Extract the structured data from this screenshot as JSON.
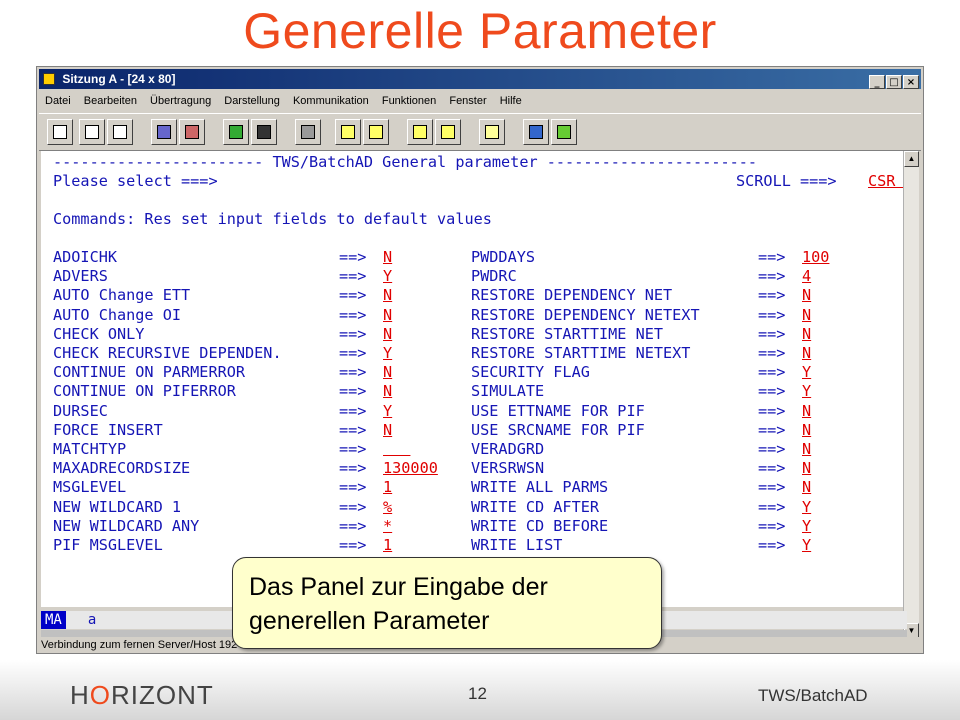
{
  "slide": {
    "title": "Generelle Parameter",
    "callout_line1": "Das Panel zur Eingabe der",
    "callout_line2": "generellen Parameter",
    "brand_pre": "H",
    "brand_o": "O",
    "brand_post": "RIZONT",
    "page_number": "12",
    "product": "TWS/BatchAD"
  },
  "window": {
    "title": "Sitzung A - [24 x 80]",
    "menu": [
      "Datei",
      "Bearbeiten",
      "Übertragung",
      "Darstellung",
      "Kommunikation",
      "Funktionen",
      "Fenster",
      "Hilfe"
    ],
    "toolbar_icons": [
      "print-screen-icon",
      "copy-icon",
      "paste-icon",
      "send-file-icon",
      "receive-file-icon",
      "display-setup-icon",
      "color-icon",
      "macro-icon",
      "record-macro-icon",
      "play-macro-icon",
      "stop-macro-icon",
      "pause-macro-icon",
      "clipboard-icon",
      "help-icon",
      "support-icon"
    ],
    "status_ma": "MA",
    "status_cursor": "a",
    "connection_text": "Verbindung zum fernen Server/Host 192"
  },
  "terminal": {
    "header_line": "----------------------- TWS/BatchAD General parameter -----------------------",
    "prompt_label": "Please select ===>",
    "scroll_label": "SCROLL ===>",
    "scroll_value": "CSR ",
    "commands_line": "Commands: Res set input fields to default values",
    "arrow": "==>",
    "left_params": [
      {
        "name": "ADOICHK",
        "value": "N"
      },
      {
        "name": "ADVERS",
        "value": "Y"
      },
      {
        "name": "AUTO Change ETT",
        "value": "N"
      },
      {
        "name": "AUTO Change OI",
        "value": "N"
      },
      {
        "name": "CHECK ONLY",
        "value": "N"
      },
      {
        "name": "CHECK RECURSIVE DEPENDEN.",
        "value": "Y"
      },
      {
        "name": "CONTINUE ON PARMERROR",
        "value": "N"
      },
      {
        "name": "CONTINUE ON PIFERROR",
        "value": "N"
      },
      {
        "name": "DURSEC",
        "value": "Y"
      },
      {
        "name": "FORCE INSERT",
        "value": "N"
      },
      {
        "name": "MATCHTYP",
        "value": "   "
      },
      {
        "name": "MAXADRECORDSIZE",
        "value": "130000"
      },
      {
        "name": "MSGLEVEL",
        "value": "1"
      },
      {
        "name": "NEW WILDCARD 1",
        "value": "%"
      },
      {
        "name": "NEW WILDCARD ANY",
        "value": "*"
      },
      {
        "name": "PIF MSGLEVEL",
        "value": "1"
      }
    ],
    "right_params": [
      {
        "name": "PWDDAYS",
        "value": "100"
      },
      {
        "name": "PWDRC",
        "value": "4"
      },
      {
        "name": "RESTORE DEPENDENCY NET",
        "value": "N"
      },
      {
        "name": "RESTORE DEPENDENCY NETEXT",
        "value": "N"
      },
      {
        "name": "RESTORE STARTTIME NET",
        "value": "N"
      },
      {
        "name": "RESTORE STARTTIME NETEXT",
        "value": "N"
      },
      {
        "name": "SECURITY FLAG",
        "value": "Y"
      },
      {
        "name": "SIMULATE",
        "value": "Y"
      },
      {
        "name": "USE ETTNAME FOR PIF",
        "value": "N"
      },
      {
        "name": "USE SRCNAME FOR PIF",
        "value": "N"
      },
      {
        "name": "VERADGRD",
        "value": "N"
      },
      {
        "name": "VERSRWSN",
        "value": "N"
      },
      {
        "name": "WRITE ALL PARMS",
        "value": "N"
      },
      {
        "name": "WRITE CD AFTER",
        "value": "Y"
      },
      {
        "name": "WRITE CD BEFORE",
        "value": "Y"
      },
      {
        "name": "WRITE LIST",
        "value": "Y"
      }
    ]
  },
  "colors": {
    "title_orange": "#ef4a1d",
    "terminal_blue": "#1515b5",
    "value_red": "#e00000",
    "callout_bg": "#ffffcc"
  }
}
